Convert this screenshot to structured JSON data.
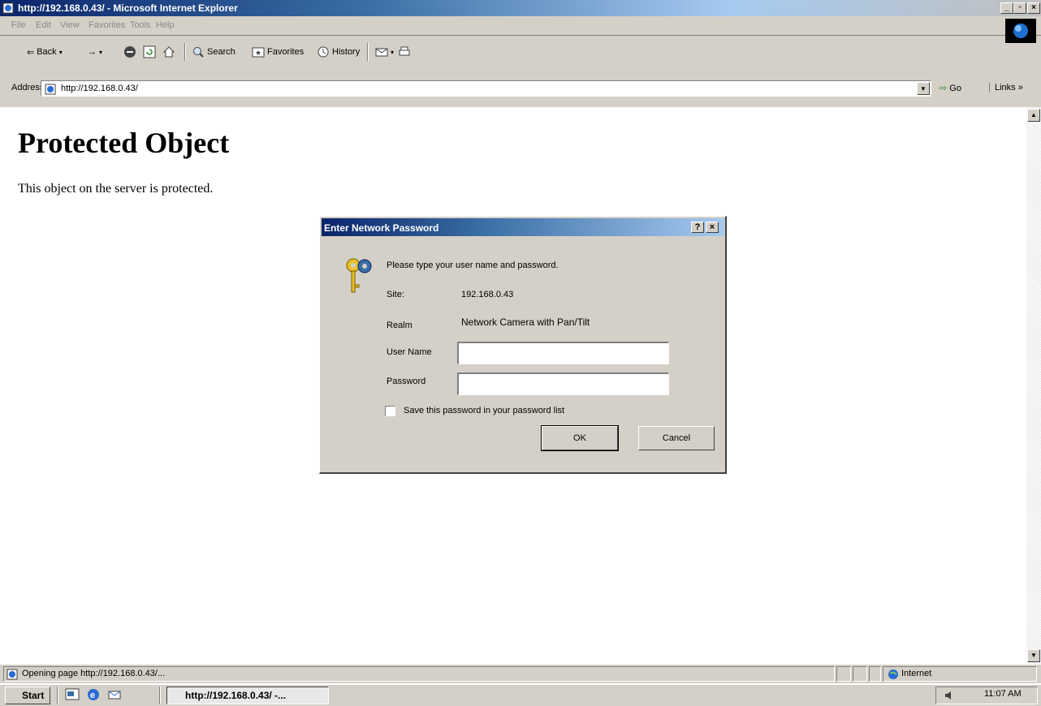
{
  "window": {
    "title": "http://192.168.0.43/ - Microsoft Internet Explorer"
  },
  "menu": [
    "File",
    "Edit",
    "View",
    "Favorites",
    "Tools",
    "Help"
  ],
  "toolbar": {
    "back": "Back",
    "search": "Search",
    "favorites": "Favorites",
    "history": "History"
  },
  "address": {
    "label": "Address",
    "value": "http://192.168.0.43/",
    "go": "Go",
    "links": "Links »"
  },
  "page": {
    "title": "Protected Object",
    "text": "This object on the server is protected."
  },
  "dialog": {
    "title": "Enter Network Password",
    "prompt": "Please type your user name and password.",
    "site_label": "Site:",
    "site_value": "192.168.0.43",
    "realm_label": "Realm",
    "realm_value": "Network Camera with Pan/Tilt",
    "username_label": "User Name",
    "username_value": "",
    "password_label": "Password",
    "password_value": "",
    "save_label": "Save this password in your password list",
    "ok": "OK",
    "cancel": "Cancel"
  },
  "status": {
    "text": "Opening page http://192.168.0.43/...",
    "zone": "Internet"
  },
  "taskbar": {
    "start": "Start",
    "task": "http://192.168.0.43/ -...",
    "clock": "11:07 AM"
  },
  "colors": {
    "title_active": "#0a246a",
    "chrome": "#d4d0c8"
  }
}
